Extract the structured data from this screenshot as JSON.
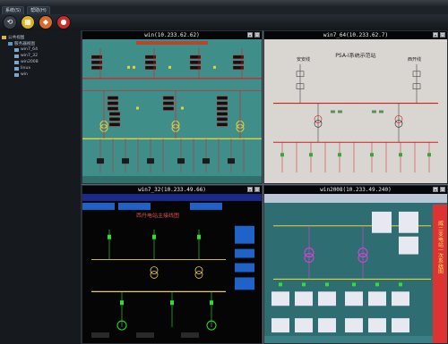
{
  "menu": [
    "系统(S)",
    "帮助(H)"
  ],
  "toolbar": [
    {
      "icon": "refresh-icon",
      "color": "#3b4048"
    },
    {
      "icon": "grid-icon",
      "color": "#d7b32a"
    },
    {
      "icon": "tile-icon",
      "color": "#d86a2a"
    },
    {
      "icon": "stop-icon",
      "color": "#c82b2b"
    }
  ],
  "tree": [
    {
      "label": "公共视图",
      "depth": 0,
      "icon": "folder-icon"
    },
    {
      "label": "服务器视图",
      "depth": 1,
      "icon": "server-group-icon"
    },
    {
      "label": "win7_64",
      "depth": 2,
      "icon": "monitor-icon"
    },
    {
      "label": "win7_32",
      "depth": 2,
      "icon": "monitor-icon"
    },
    {
      "label": "win2008",
      "depth": 2,
      "icon": "monitor-icon"
    },
    {
      "label": "linux",
      "depth": 2,
      "icon": "monitor-icon"
    },
    {
      "label": "win",
      "depth": 2,
      "icon": "monitor-icon"
    }
  ],
  "panes": [
    {
      "title": "win(10.233.62.62)"
    },
    {
      "title": "win7_64(10.233.62.7)",
      "diagram_title": "PSA-I系统示范站",
      "label_left": "安安线",
      "label_right": "西开线"
    },
    {
      "title": "win7_32(10.233.49.66)",
      "diagram_title": "西丹电站主接线图"
    },
    {
      "title": "win2008(10.233.49.240)",
      "side_label": "威二变电站一次系统图"
    }
  ],
  "colors": {
    "teal": "#3f8e8a",
    "red": "#e02020",
    "green": "#33dd33",
    "yellow": "#e8d23a",
    "magenta": "#e040e0",
    "blue": "#1f63c9"
  }
}
